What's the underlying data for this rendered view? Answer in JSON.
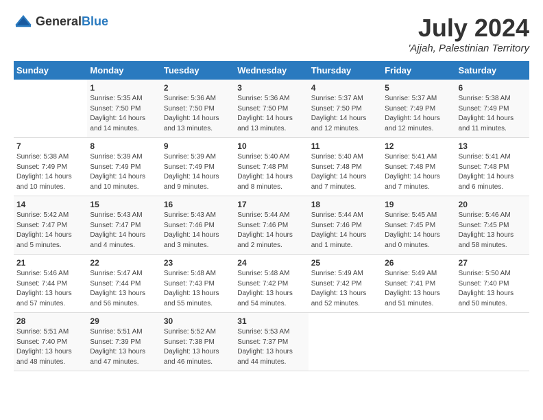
{
  "logo": {
    "text_general": "General",
    "text_blue": "Blue"
  },
  "title": "July 2024",
  "subtitle": "'Ajjah, Palestinian Territory",
  "days_of_week": [
    "Sunday",
    "Monday",
    "Tuesday",
    "Wednesday",
    "Thursday",
    "Friday",
    "Saturday"
  ],
  "weeks": [
    [
      {
        "day": "",
        "sunrise": "",
        "sunset": "",
        "daylight": ""
      },
      {
        "day": "1",
        "sunrise": "Sunrise: 5:35 AM",
        "sunset": "Sunset: 7:50 PM",
        "daylight": "Daylight: 14 hours and 14 minutes."
      },
      {
        "day": "2",
        "sunrise": "Sunrise: 5:36 AM",
        "sunset": "Sunset: 7:50 PM",
        "daylight": "Daylight: 14 hours and 13 minutes."
      },
      {
        "day": "3",
        "sunrise": "Sunrise: 5:36 AM",
        "sunset": "Sunset: 7:50 PM",
        "daylight": "Daylight: 14 hours and 13 minutes."
      },
      {
        "day": "4",
        "sunrise": "Sunrise: 5:37 AM",
        "sunset": "Sunset: 7:50 PM",
        "daylight": "Daylight: 14 hours and 12 minutes."
      },
      {
        "day": "5",
        "sunrise": "Sunrise: 5:37 AM",
        "sunset": "Sunset: 7:49 PM",
        "daylight": "Daylight: 14 hours and 12 minutes."
      },
      {
        "day": "6",
        "sunrise": "Sunrise: 5:38 AM",
        "sunset": "Sunset: 7:49 PM",
        "daylight": "Daylight: 14 hours and 11 minutes."
      }
    ],
    [
      {
        "day": "7",
        "sunrise": "Sunrise: 5:38 AM",
        "sunset": "Sunset: 7:49 PM",
        "daylight": "Daylight: 14 hours and 10 minutes."
      },
      {
        "day": "8",
        "sunrise": "Sunrise: 5:39 AM",
        "sunset": "Sunset: 7:49 PM",
        "daylight": "Daylight: 14 hours and 10 minutes."
      },
      {
        "day": "9",
        "sunrise": "Sunrise: 5:39 AM",
        "sunset": "Sunset: 7:49 PM",
        "daylight": "Daylight: 14 hours and 9 minutes."
      },
      {
        "day": "10",
        "sunrise": "Sunrise: 5:40 AM",
        "sunset": "Sunset: 7:48 PM",
        "daylight": "Daylight: 14 hours and 8 minutes."
      },
      {
        "day": "11",
        "sunrise": "Sunrise: 5:40 AM",
        "sunset": "Sunset: 7:48 PM",
        "daylight": "Daylight: 14 hours and 7 minutes."
      },
      {
        "day": "12",
        "sunrise": "Sunrise: 5:41 AM",
        "sunset": "Sunset: 7:48 PM",
        "daylight": "Daylight: 14 hours and 7 minutes."
      },
      {
        "day": "13",
        "sunrise": "Sunrise: 5:41 AM",
        "sunset": "Sunset: 7:48 PM",
        "daylight": "Daylight: 14 hours and 6 minutes."
      }
    ],
    [
      {
        "day": "14",
        "sunrise": "Sunrise: 5:42 AM",
        "sunset": "Sunset: 7:47 PM",
        "daylight": "Daylight: 14 hours and 5 minutes."
      },
      {
        "day": "15",
        "sunrise": "Sunrise: 5:43 AM",
        "sunset": "Sunset: 7:47 PM",
        "daylight": "Daylight: 14 hours and 4 minutes."
      },
      {
        "day": "16",
        "sunrise": "Sunrise: 5:43 AM",
        "sunset": "Sunset: 7:46 PM",
        "daylight": "Daylight: 14 hours and 3 minutes."
      },
      {
        "day": "17",
        "sunrise": "Sunrise: 5:44 AM",
        "sunset": "Sunset: 7:46 PM",
        "daylight": "Daylight: 14 hours and 2 minutes."
      },
      {
        "day": "18",
        "sunrise": "Sunrise: 5:44 AM",
        "sunset": "Sunset: 7:46 PM",
        "daylight": "Daylight: 14 hours and 1 minute."
      },
      {
        "day": "19",
        "sunrise": "Sunrise: 5:45 AM",
        "sunset": "Sunset: 7:45 PM",
        "daylight": "Daylight: 14 hours and 0 minutes."
      },
      {
        "day": "20",
        "sunrise": "Sunrise: 5:46 AM",
        "sunset": "Sunset: 7:45 PM",
        "daylight": "Daylight: 13 hours and 58 minutes."
      }
    ],
    [
      {
        "day": "21",
        "sunrise": "Sunrise: 5:46 AM",
        "sunset": "Sunset: 7:44 PM",
        "daylight": "Daylight: 13 hours and 57 minutes."
      },
      {
        "day": "22",
        "sunrise": "Sunrise: 5:47 AM",
        "sunset": "Sunset: 7:44 PM",
        "daylight": "Daylight: 13 hours and 56 minutes."
      },
      {
        "day": "23",
        "sunrise": "Sunrise: 5:48 AM",
        "sunset": "Sunset: 7:43 PM",
        "daylight": "Daylight: 13 hours and 55 minutes."
      },
      {
        "day": "24",
        "sunrise": "Sunrise: 5:48 AM",
        "sunset": "Sunset: 7:42 PM",
        "daylight": "Daylight: 13 hours and 54 minutes."
      },
      {
        "day": "25",
        "sunrise": "Sunrise: 5:49 AM",
        "sunset": "Sunset: 7:42 PM",
        "daylight": "Daylight: 13 hours and 52 minutes."
      },
      {
        "day": "26",
        "sunrise": "Sunrise: 5:49 AM",
        "sunset": "Sunset: 7:41 PM",
        "daylight": "Daylight: 13 hours and 51 minutes."
      },
      {
        "day": "27",
        "sunrise": "Sunrise: 5:50 AM",
        "sunset": "Sunset: 7:40 PM",
        "daylight": "Daylight: 13 hours and 50 minutes."
      }
    ],
    [
      {
        "day": "28",
        "sunrise": "Sunrise: 5:51 AM",
        "sunset": "Sunset: 7:40 PM",
        "daylight": "Daylight: 13 hours and 48 minutes."
      },
      {
        "day": "29",
        "sunrise": "Sunrise: 5:51 AM",
        "sunset": "Sunset: 7:39 PM",
        "daylight": "Daylight: 13 hours and 47 minutes."
      },
      {
        "day": "30",
        "sunrise": "Sunrise: 5:52 AM",
        "sunset": "Sunset: 7:38 PM",
        "daylight": "Daylight: 13 hours and 46 minutes."
      },
      {
        "day": "31",
        "sunrise": "Sunrise: 5:53 AM",
        "sunset": "Sunset: 7:37 PM",
        "daylight": "Daylight: 13 hours and 44 minutes."
      },
      {
        "day": "",
        "sunrise": "",
        "sunset": "",
        "daylight": ""
      },
      {
        "day": "",
        "sunrise": "",
        "sunset": "",
        "daylight": ""
      },
      {
        "day": "",
        "sunrise": "",
        "sunset": "",
        "daylight": ""
      }
    ]
  ]
}
